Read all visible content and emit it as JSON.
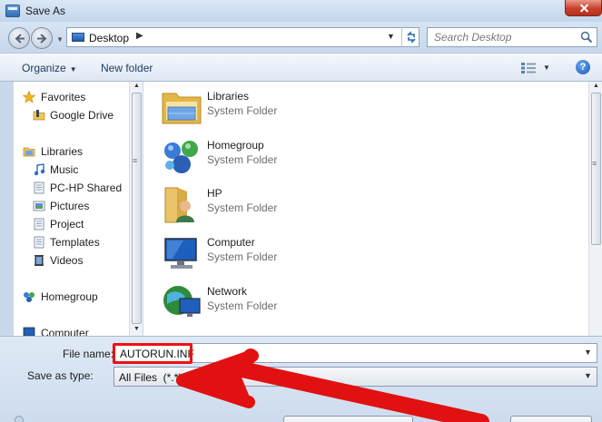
{
  "window": {
    "title": "Save As",
    "icon": "save-dialog-icon",
    "close_icon": "close-icon"
  },
  "navigation": {
    "back_icon": "back-arrow-icon",
    "forward_icon": "forward-arrow-icon",
    "address_crumb": "Desktop",
    "address_icon": "desktop-icon",
    "refresh_icon": "refresh-icon",
    "search_placeholder": "Search Desktop",
    "search_icon": "search-icon"
  },
  "toolbar": {
    "organize_label": "Organize",
    "new_folder_label": "New folder",
    "views_icon": "change-view-icon",
    "help_label": "?"
  },
  "sidebar": {
    "items": [
      {
        "label": "Favorites",
        "icon": "star-icon"
      },
      {
        "label": "Google Drive",
        "icon": "google-drive-icon"
      },
      {
        "label": "Libraries",
        "icon": "libraries-icon"
      },
      {
        "label": "Music",
        "icon": "music-icon"
      },
      {
        "label": "PC-HP Shared",
        "icon": "document-library-icon"
      },
      {
        "label": "Pictures",
        "icon": "pictures-icon"
      },
      {
        "label": "Project",
        "icon": "document-library-icon"
      },
      {
        "label": "Templates",
        "icon": "document-library-icon"
      },
      {
        "label": "Videos",
        "icon": "videos-icon"
      },
      {
        "label": "Homegroup",
        "icon": "homegroup-icon"
      },
      {
        "label": "Computer",
        "icon": "computer-icon"
      }
    ]
  },
  "files": [
    {
      "name": "Libraries",
      "type": "System Folder",
      "icon": "libraries-folder-icon"
    },
    {
      "name": "Homegroup",
      "type": "System Folder",
      "icon": "homegroup-icon"
    },
    {
      "name": "HP",
      "type": "System Folder",
      "icon": "user-folder-icon"
    },
    {
      "name": "Computer",
      "type": "System Folder",
      "icon": "computer-icon"
    },
    {
      "name": "Network",
      "type": "System Folder",
      "icon": "network-icon"
    }
  ],
  "form": {
    "file_name_label": "File name:",
    "file_name_value": "AUTORUN.INF",
    "save_type_label": "Save as type:",
    "save_type_value": "All Files  (*.*)"
  },
  "annotation": {
    "highlight_color": "#e11111",
    "arrow_color": "#e11111"
  }
}
